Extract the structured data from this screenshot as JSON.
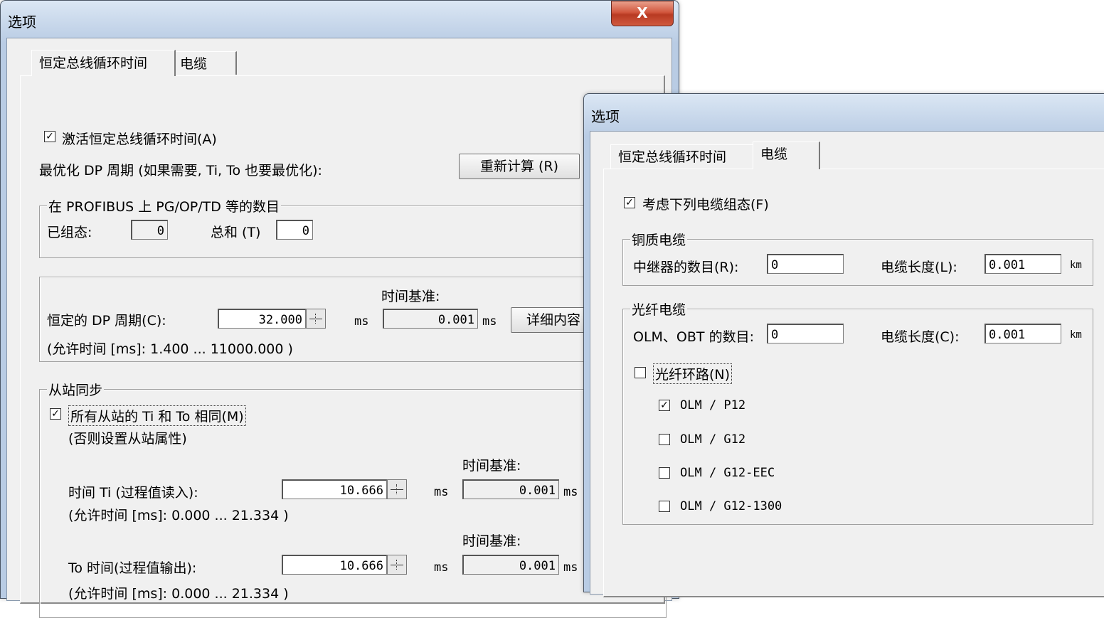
{
  "left_dialog": {
    "title": "选项",
    "close_label": "X",
    "tabs": [
      {
        "label": "恒定总线循环时间"
      },
      {
        "label": "电缆"
      }
    ],
    "activate_label": "激活恒定总线循环时间(A)",
    "optimize_label": "最优化 DP 周期 (如果需要, Ti, To 也要最优化):",
    "recalc_button": "重新计算 (R)",
    "pg_group": {
      "title": "在 PROFIBUS 上 PG/OP/TD 等的数目",
      "configured_label": "已组态:",
      "configured_value": "0",
      "total_label": "总和 (T)",
      "total_value": "0"
    },
    "dp_group": {
      "timebase_label": "时间基准:",
      "period_label": "恒定的 DP 周期(C):",
      "period_value": "32.000",
      "unit1": "ms",
      "timebase_value": "0.001",
      "unit2": "ms",
      "details_button": "详细内容",
      "allowed": "(允许时间 [ms]:  1.400 ... 11000.000 )"
    },
    "slave_group": {
      "title": "从站同步",
      "same_label": "所有从站的 Ti 和 To 相同(M)",
      "note": "(否则设置从站属性)",
      "timebase1_label": "时间基准:",
      "ti_label": "时间 Ti (过程值读入):",
      "ti_value": "10.666",
      "ti_unit": "ms",
      "ti_timebase": "0.001",
      "ti_timebase_unit": "ms",
      "ti_allowed": "(允许时间 [ms]:  0.000 ... 21.334 )",
      "timebase2_label": "时间基准:",
      "to_label": "To 时间(过程值输出):",
      "to_value": "10.666",
      "to_unit": "ms",
      "to_timebase": "0.001",
      "to_timebase_unit": "ms",
      "to_allowed": "(允许时间 [ms]:  0.000 ... 21.334 )"
    }
  },
  "right_dialog": {
    "title": "选项",
    "tabs": [
      {
        "label": "恒定总线循环时间"
      },
      {
        "label": "电缆"
      }
    ],
    "consider_label": "考虑下列电缆组态(F)",
    "copper_group": {
      "title": "铜质电缆",
      "repeater_label": "中继器的数目(R):",
      "repeater_value": "0",
      "length_label": "电缆长度(L):",
      "length_value": "0.001",
      "unit": "km"
    },
    "fiber_group": {
      "title": "光纤电缆",
      "olm_label": "OLM、OBT 的数目:",
      "olm_value": "0",
      "length_label": "电缆长度(C):",
      "length_value": "0.001",
      "unit": "km",
      "ring_label": "光纤环路(N)",
      "options": [
        {
          "label": "OLM / P12",
          "checked": true
        },
        {
          "label": "OLM / G12",
          "checked": false
        },
        {
          "label": "OLM / G12-EEC",
          "checked": false
        },
        {
          "label": "OLM / G12-1300",
          "checked": false
        }
      ]
    }
  },
  "icons": {
    "check": "check-icon",
    "close": "close-icon"
  }
}
